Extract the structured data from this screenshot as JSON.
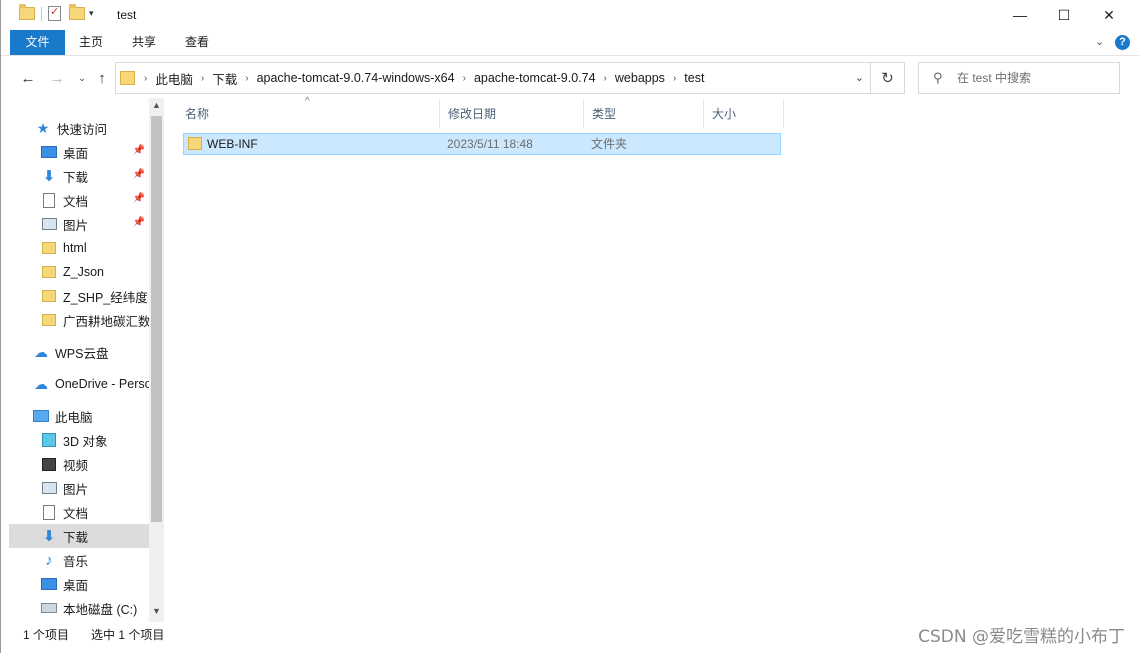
{
  "window": {
    "title": "test"
  },
  "title_controls": {
    "minimize": "—",
    "maximize": "☐",
    "close": "✕"
  },
  "ribbon": {
    "tabs": [
      "文件",
      "主页",
      "共享",
      "查看"
    ],
    "expand": "⌄",
    "help": "?"
  },
  "address": {
    "crumbs": [
      "此电脑",
      "下载",
      "apache-tomcat-9.0.74-windows-x64",
      "apache-tomcat-9.0.74",
      "webapps",
      "test"
    ]
  },
  "search": {
    "placeholder": "在 test 中搜索"
  },
  "nav_pane": {
    "quick_access": "快速访问",
    "items": [
      {
        "label": "桌面",
        "icon": "desktop-icon",
        "pinned": true
      },
      {
        "label": "下载",
        "icon": "download-icon",
        "pinned": true
      },
      {
        "label": "文档",
        "icon": "document-icon",
        "pinned": true
      },
      {
        "label": "图片",
        "icon": "picture-icon",
        "pinned": true
      },
      {
        "label": "html",
        "icon": "folder-icon"
      },
      {
        "label": "Z_Json",
        "icon": "folder-icon"
      },
      {
        "label": "Z_SHP_经纬度",
        "icon": "folder-icon"
      },
      {
        "label": "广西耕地碳汇数",
        "icon": "folder-icon"
      }
    ],
    "wps": "WPS云盘",
    "onedrive": "OneDrive - Perso",
    "this_pc": "此电脑",
    "pc_items": [
      {
        "label": "3D 对象",
        "icon": "3d-objects-icon"
      },
      {
        "label": "视频",
        "icon": "video-icon"
      },
      {
        "label": "图片",
        "icon": "picture-icon"
      },
      {
        "label": "文档",
        "icon": "document-icon"
      },
      {
        "label": "下载",
        "icon": "download-icon",
        "selected": true
      },
      {
        "label": "音乐",
        "icon": "music-icon"
      },
      {
        "label": "桌面",
        "icon": "desktop-icon"
      },
      {
        "label": "本地磁盘 (C:)",
        "icon": "drive-icon"
      }
    ]
  },
  "columns": {
    "name": "名称",
    "date": "修改日期",
    "type": "类型",
    "size": "大小"
  },
  "files": [
    {
      "name": "WEB-INF",
      "date": "2023/5/11 18:48",
      "type": "文件夹",
      "size": ""
    }
  ],
  "status": {
    "count": "1 个项目",
    "selected": "选中 1 个项目"
  },
  "watermark": "CSDN @爱吃雪糕的小布丁"
}
